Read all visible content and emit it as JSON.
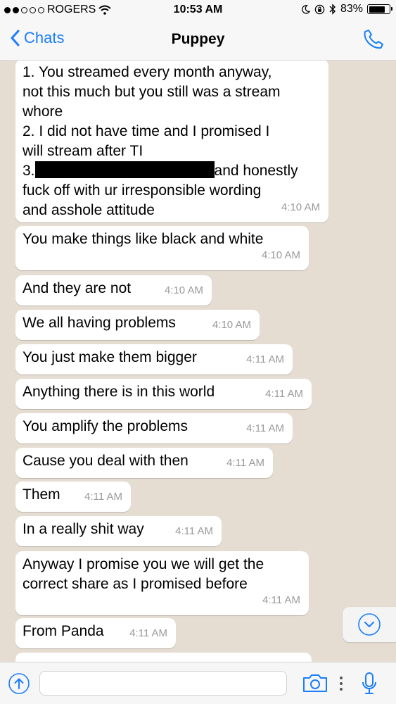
{
  "status_bar": {
    "carrier": "ROGERS",
    "time": "10:53 AM",
    "battery": "83%",
    "battery_level": 0.83,
    "signal_bars": 2
  },
  "nav": {
    "back_label": "Chats",
    "title": "Puppey"
  },
  "messages": [
    {
      "text": "1. You streamed every month anyway,\nnot this much but you still was a stream\nwhore\n2. I did not have time and I promised I\nwill stream after TI\n3.",
      "text_after": "and honestly\nfuck off with ur irresponsible wording\nand asshole attitude",
      "time": "4:10 AM"
    },
    {
      "text": "You make things like black and white",
      "time": "4:10 AM"
    },
    {
      "text": "And they are not",
      "time": "4:10 AM"
    },
    {
      "text": "We all having problems",
      "time": "4:10 AM"
    },
    {
      "text": "You just make them bigger",
      "time": "4:11 AM"
    },
    {
      "text": "Anything there is in this world",
      "time": "4:11 AM"
    },
    {
      "text": "You amplify the problems",
      "time": "4:11 AM"
    },
    {
      "text": "Cause you deal with then",
      "time": "4:11 AM"
    },
    {
      "text": "Them",
      "time": "4:11 AM"
    },
    {
      "text": "In a really shit way",
      "time": "4:11 AM"
    },
    {
      "text": "Anyway I promise you we will get the\ncorrect share as I promised before",
      "time": "4:11 AM"
    },
    {
      "text": "From Panda",
      "time": "4:11 AM"
    }
  ],
  "input": {
    "value": "",
    "placeholder": ""
  },
  "colors": {
    "accent": "#1a7efb",
    "chat_background": "#e5ddd2",
    "bubble": "#ffffff",
    "timestamp": "#9a9a9a"
  },
  "icons": {
    "back": "chevron-left-icon",
    "call": "phone-icon",
    "scroll_down": "chevron-down-circle-icon",
    "attach": "arrow-up-circle-icon",
    "camera": "camera-icon",
    "more": "more-dots-icon",
    "mic": "microphone-icon"
  }
}
